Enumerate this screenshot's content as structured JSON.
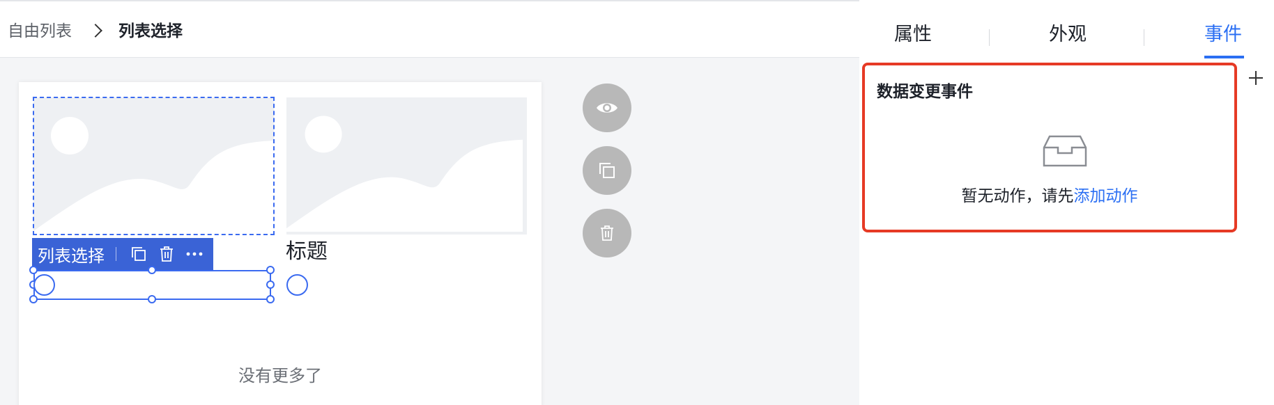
{
  "breadcrumb": {
    "parent": "自由列表",
    "current": "列表选择"
  },
  "canvas": {
    "card_title": "标题",
    "no_more": "没有更多了",
    "selection_toolbar": {
      "label": "列表选择"
    }
  },
  "panel": {
    "tabs": [
      "属性",
      "外观",
      "事件"
    ],
    "active_tab": "事件",
    "event_title": "数据变更事件",
    "empty_text": "暂无动作，请先",
    "empty_link": "添加动作"
  },
  "colors": {
    "accent": "#2b6ff3",
    "selection": "#3a63d6",
    "highlight_border": "#e63a25",
    "fab": "#b8b8b8"
  },
  "icons": [
    "chevron-right-icon",
    "image-placeholder-icon",
    "copy-icon",
    "trash-icon",
    "more-icon",
    "eye-icon",
    "empty-box-icon",
    "plus-icon"
  ]
}
